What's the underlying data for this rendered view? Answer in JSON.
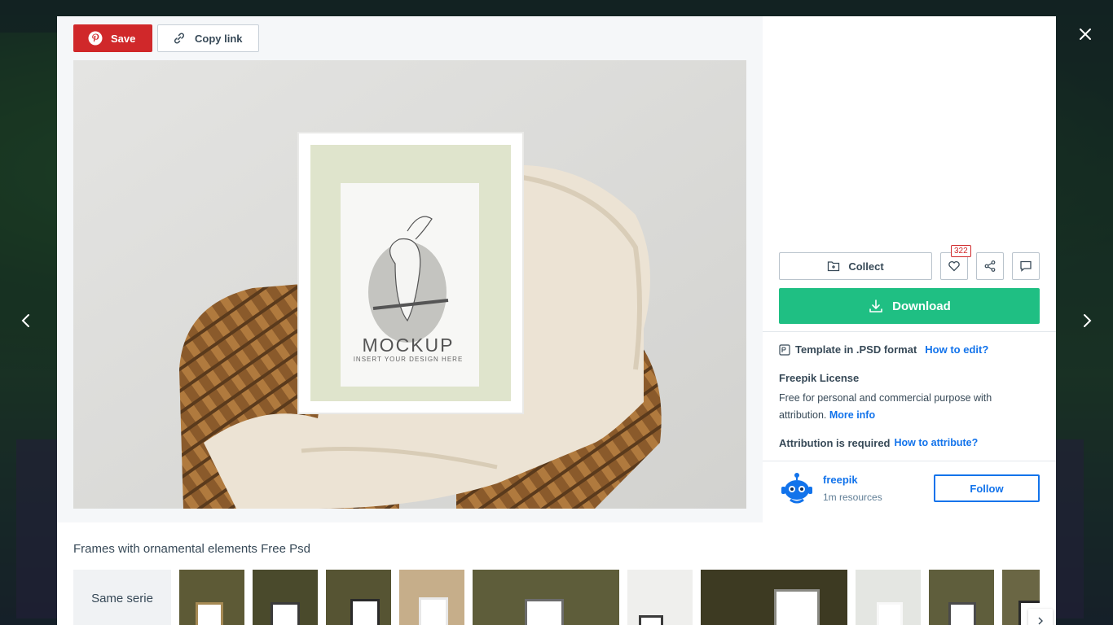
{
  "toolbar": {
    "save_label": "Save",
    "copy_link_label": "Copy link"
  },
  "main_image": {
    "mockup_title": "MOCKUP",
    "mockup_subtitle": "INSERT YOUR DESIGN HERE"
  },
  "actions": {
    "collect_label": "Collect",
    "like_count": "322",
    "download_label": "Download"
  },
  "details": {
    "format_text": "Template in .PSD format",
    "how_to_edit": "How to edit?",
    "license_title": "Freepik License",
    "license_text": "Free for personal and commercial purpose with attribution.",
    "more_info": "More info",
    "attribution_text": "Attribution is required",
    "how_to_attribute": "How to attribute?"
  },
  "author": {
    "name": "freepik",
    "resources": "1m resources",
    "follow_label": "Follow"
  },
  "related": {
    "title": "Frames with ornamental elements Free Psd",
    "same_serie_label": "Same serie"
  },
  "colors": {
    "save_red": "#d0282a",
    "download_green": "#1fbf83",
    "link_blue": "#1273eb",
    "text_dark": "#374957"
  }
}
